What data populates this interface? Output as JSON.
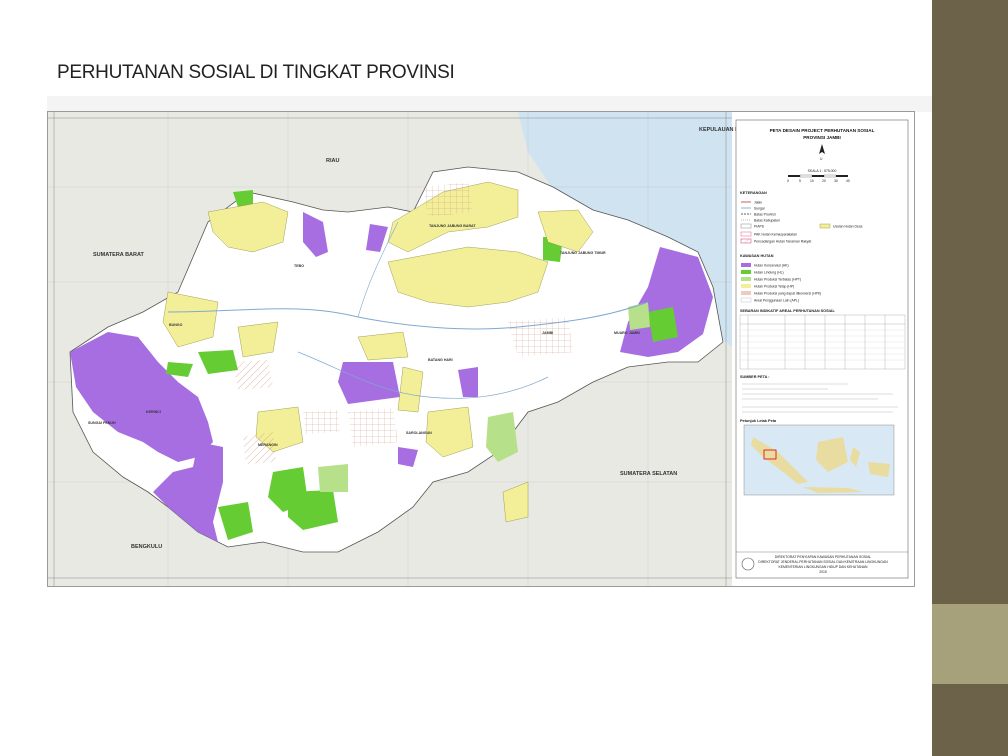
{
  "slide": {
    "title": "PERHUTANAN SOSIAL  DI TINGKAT PROVINSI"
  },
  "colors": {
    "sidebar_dark": "#6b6249",
    "sidebar_light": "#a6a07b",
    "sea": "#cfe3f0",
    "land_outside": "#e9e9e4",
    "province": "#ffffff",
    "hutan_konservasi": "#a66ee0",
    "hutan_lindung": "#66cc33",
    "hutan_produksi_terbatas": "#b7e08a",
    "hutan_produksi_tetap": "#f3ef99",
    "hutan_produksi_konversi": "#f2c9c0",
    "apl": "#ffffff"
  },
  "map": {
    "neighbors": {
      "riau": "RIAU",
      "sumbar": "SUMATERA BARAT",
      "bengkulu": "BENGKULU",
      "sumsel": "SUMATERA SELATAN",
      "kepri": "KEPULAUAN RIAU"
    },
    "districts": {
      "tebo": "TEBO",
      "bungo": "BUNGO",
      "kerinci": "KERINCI",
      "sungai_penuh": "SUNGAI PENUH",
      "merangin": "MERANGIN",
      "sarolangun": "SAROLANGUN",
      "batang_hari": "BATANG HARI",
      "jambi": "JAMBI",
      "muaro_jambi": "MUARO JAMBI",
      "tanjab_barat": "TANJUNG JABUNG BARAT",
      "tanjab_timur": "TANJUNG JABUNG TIMUR"
    }
  },
  "legend": {
    "title": "PETA DESAIN PROJECT PERHUTANAN SOSIAL",
    "subtitle": "PROVINSI JAMBI",
    "north": "U",
    "scale": "SKALA 1 : 575.000",
    "scale_ticks": [
      "0",
      "5",
      "10",
      "20",
      "30",
      "40"
    ],
    "keterangan": "KETERANGAN",
    "lines": [
      "Jalan",
      "Sungai",
      "Batas Provinsi",
      "Batas Kabupaten",
      "PIAPS",
      "Usulan Hutan Desa"
    ],
    "permits": [
      "PAK Hutan Kemasyarakatan",
      "Pencadangan Hutan Tanaman Rakyat"
    ],
    "kawasan_title": "KAWASAN HUTAN",
    "kawasan": [
      "Hutan Konservasi (HK)",
      "Hutan Lindung (HL)",
      "Hutan Produksi Terbatas (HPT)",
      "Hutan Produksi Tetap (HP)",
      "Hutan Produksi yang dapat dikonversi (HPK)",
      "Areal Penggunaan Lain (APL)"
    ],
    "table_title": "SEBARAN INDIKATIF AREAL PERHUTANAN SOSIAL",
    "sumber_title": "SUMBER PETA :",
    "inset_title": "Petunjuk Letak Peta",
    "agency": [
      "DIREKTORAT PENYIAPAN KAWASAN PERHUTANAN SOSIAL",
      "DIREKTORAT JENDERAL PERHUTANAN SOSIAL DAN KEMITRAAN LINGKUNGAN",
      "KEMENTERIAN LINGKUNGAN HIDUP DAN KEHUTANAN",
      "2015"
    ]
  }
}
